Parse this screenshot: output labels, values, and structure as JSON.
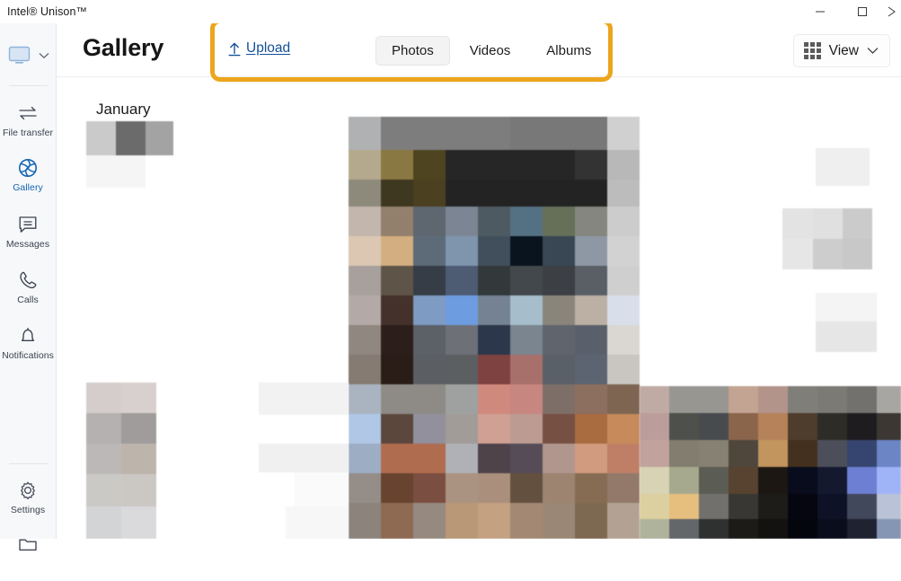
{
  "window": {
    "app_title": "Intel® Unison™",
    "controls": [
      {
        "name": "minimize",
        "glyph": "minimize-icon"
      },
      {
        "name": "maximize",
        "glyph": "maximize-icon"
      },
      {
        "name": "close",
        "glyph": "close-icon"
      }
    ]
  },
  "sidebar": {
    "device_selector": {
      "icon": "monitor-icon",
      "chevron": "chevron-down-icon"
    },
    "items": [
      {
        "label": "File transfer",
        "icon": "file-transfer-icon",
        "active": false
      },
      {
        "label": "Gallery",
        "icon": "gallery-icon",
        "active": true
      },
      {
        "label": "Messages",
        "icon": "messages-icon",
        "active": false
      },
      {
        "label": "Calls",
        "icon": "calls-icon",
        "active": false
      },
      {
        "label": "Notifications",
        "icon": "bell-icon",
        "active": false
      },
      {
        "label": "Settings",
        "icon": "gear-icon",
        "active": false
      },
      {
        "label": "",
        "icon": "folder-icon",
        "active": false
      }
    ]
  },
  "header": {
    "title": "Gallery",
    "upload": {
      "label": "Upload",
      "icon": "upload-arrow-icon"
    },
    "tabs": [
      {
        "label": "Photos",
        "selected": true
      },
      {
        "label": "Videos",
        "selected": false
      },
      {
        "label": "Albums",
        "selected": false
      }
    ],
    "view": {
      "label": "View",
      "icon": "grid-icon",
      "chevron": "chevron-down-icon"
    }
  },
  "highlight": {
    "color": "#eda51c",
    "targets": "upload-and-tabs-toolbar"
  },
  "content": {
    "month_label": "January",
    "photo_state": "blurred-pixelated-thumbnails"
  },
  "colors": {
    "accent_link": "#12509b",
    "active_nav": "#1464b4",
    "highlight": "#eda51c",
    "sidebar_bg": "#f7f8fa",
    "tab_selected_bg": "#f3f3f3"
  }
}
